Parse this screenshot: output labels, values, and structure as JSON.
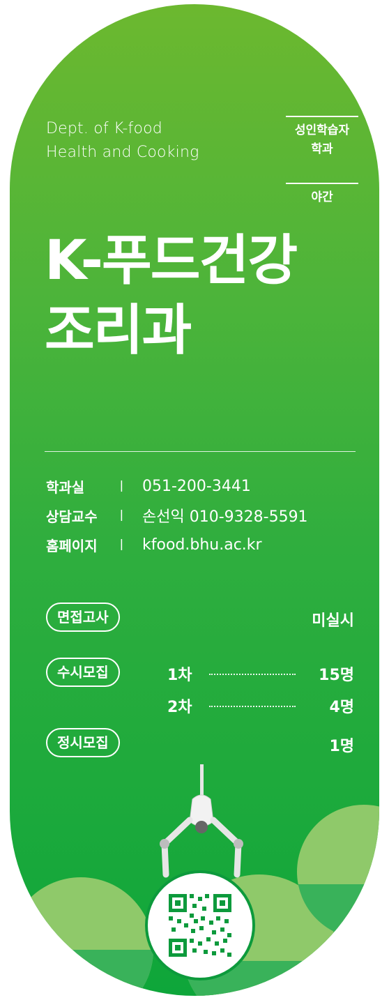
{
  "department": {
    "english_line1": "Dept. of K-food",
    "english_line2": "Health and Cooking",
    "tag_primary": "성인학습자\n학과",
    "tag_primary_line1": "성인학습자",
    "tag_primary_line2": "학과",
    "tag_secondary": "야간",
    "title_line1": "K-푸드건강",
    "title_line2": "조리과"
  },
  "contact": {
    "rows": [
      {
        "label": "학과실",
        "separator": "ㅣ",
        "value": "051-200-3441"
      },
      {
        "label": "상담교수",
        "separator": "ㅣ",
        "value": "손선익 010-9328-5591"
      },
      {
        "label": "홈페이지",
        "separator": "ㅣ",
        "value": "kfood.bhu.ac.kr"
      }
    ]
  },
  "admission": {
    "interview_label": "면접고사",
    "interview_value": "미실시",
    "early_label": "수시모집",
    "early_round1_label": "1차",
    "early_round1_value": "15명",
    "early_round2_label": "2차",
    "early_round2_value": "4명",
    "regular_label": "정시모집",
    "regular_value": "1명"
  },
  "colors": {
    "brand_green_light": "#6cb82f",
    "brand_green_dark": "#0ea63a",
    "circle_light": "#8fc96a",
    "circle_mid": "#39b25a"
  },
  "icons": [
    "claw-machine-icon",
    "qr-code-icon"
  ]
}
